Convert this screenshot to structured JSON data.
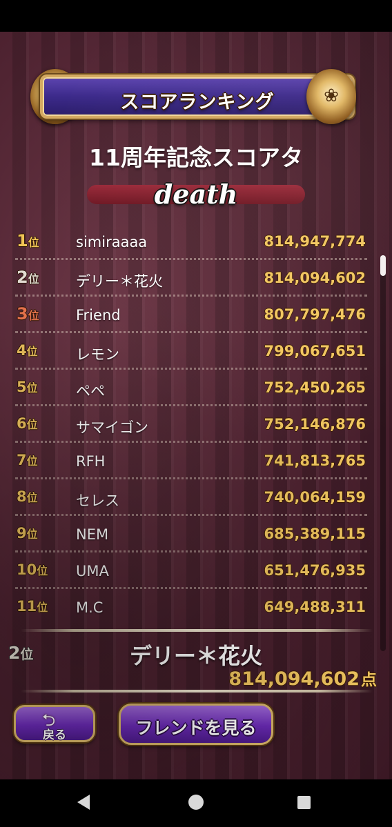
{
  "header": {
    "title": "スコアランキング",
    "subtitle": "11周年記念スコアタ",
    "difficulty": "death"
  },
  "ranking": [
    {
      "rank": "1",
      "unit": "位",
      "name": "simiraaaa",
      "score": "814,947,774"
    },
    {
      "rank": "2",
      "unit": "位",
      "name": "デリー＊花火",
      "score": "814,094,602"
    },
    {
      "rank": "3",
      "unit": "位",
      "name": "Friend",
      "score": "807,797,476"
    },
    {
      "rank": "4",
      "unit": "位",
      "name": "レモン",
      "score": "799,067,651"
    },
    {
      "rank": "5",
      "unit": "位",
      "name": "ペペ",
      "score": "752,450,265"
    },
    {
      "rank": "6",
      "unit": "位",
      "name": "サマイゴン",
      "score": "752,146,876"
    },
    {
      "rank": "7",
      "unit": "位",
      "name": "RFH",
      "score": "741,813,765"
    },
    {
      "rank": "8",
      "unit": "位",
      "name": "セレス",
      "score": "740,064,159"
    },
    {
      "rank": "9",
      "unit": "位",
      "name": "NEM",
      "score": "685,389,115"
    },
    {
      "rank": "10",
      "unit": "位",
      "name": "UMA",
      "score": "651,476,935"
    },
    {
      "rank": "11",
      "unit": "位",
      "name": "M.C",
      "score": "649,488,311"
    }
  ],
  "my_result": {
    "rank": "2",
    "rank_unit": "位",
    "name": "デリー＊花火",
    "score": "814,094,602",
    "score_unit": "点"
  },
  "buttons": {
    "back_label": "戻る",
    "back_icon": "return-arrow-icon",
    "friend_label": "フレンドを見る"
  },
  "icons": {
    "banner_ornament": "rose-ornament-icon",
    "nav_back": "triangle-back-icon",
    "nav_home": "circle-home-icon",
    "nav_recent": "square-recents-icon"
  },
  "colors": {
    "gold": "#f2c760",
    "silver": "#e2dcd2",
    "bronze": "#e5724c",
    "button_purple": "#6a2ab5",
    "background": "#4d2230"
  }
}
